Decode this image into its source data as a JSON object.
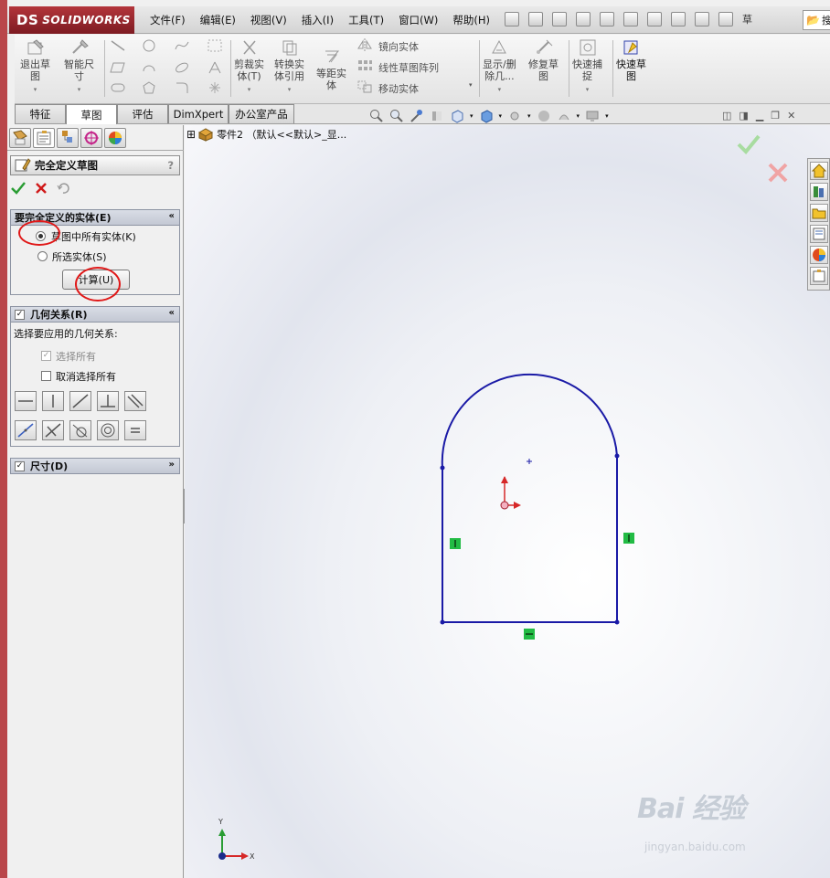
{
  "app": {
    "brand": "SOLIDWORKS",
    "brand_mark": "DS"
  },
  "menu": [
    "文件(F)",
    "编辑(E)",
    "视图(V)",
    "插入(I)",
    "工具(T)",
    "窗口(W)",
    "帮助(H)"
  ],
  "search": {
    "value": "搜"
  },
  "ribbon": {
    "exit_sketch": "退出草\n图",
    "smart_dim": "智能尺\n寸",
    "trim": "剪裁实\n体(T)",
    "convert": "转换实\n体引用",
    "offset": "等距实\n体",
    "mirror": "镜向实体",
    "linear_pattern": "线性草图阵列",
    "move": "移动实体",
    "show_delete": "显示/删\n除几...",
    "repair": "修复草\n图",
    "quick_snap": "快速捕\n捉",
    "rapid_sketch": "快速草\n图"
  },
  "tabs": [
    "特征",
    "草图",
    "评估",
    "DimXpert",
    "办公室产品"
  ],
  "active_tab": "草图",
  "property_manager": {
    "title": "完全定义草图",
    "help": "?",
    "group_entities": {
      "title": "要完全定义的实体(E)",
      "option_all": "草图中所有实体(K)",
      "option_selected": "所选实体(S)",
      "selected": "all",
      "calc_button": "计算(U)"
    },
    "group_relations": {
      "title": "几何关系(R)",
      "checked": true,
      "prompt": "选择要应用的几何关系:",
      "select_all": "选择所有",
      "select_all_checked": true,
      "deselect_all": "取消选择所有",
      "deselect_all_checked": false
    },
    "group_dimensions": {
      "title": "尺寸(D)",
      "checked": true
    }
  },
  "feature_tree": {
    "expand": "⊞",
    "label": "零件2 （默认<<默认>_显..."
  },
  "triad": {
    "x": "X",
    "y": "Y"
  },
  "watermark": {
    "brand": "Bai 经验",
    "url": "jingyan.baidu.com"
  },
  "colors": {
    "sketch_line": "#1a1aa6",
    "relation_marker": "#22bb44",
    "accent": "#b3353b",
    "annotation": "#e01818"
  }
}
